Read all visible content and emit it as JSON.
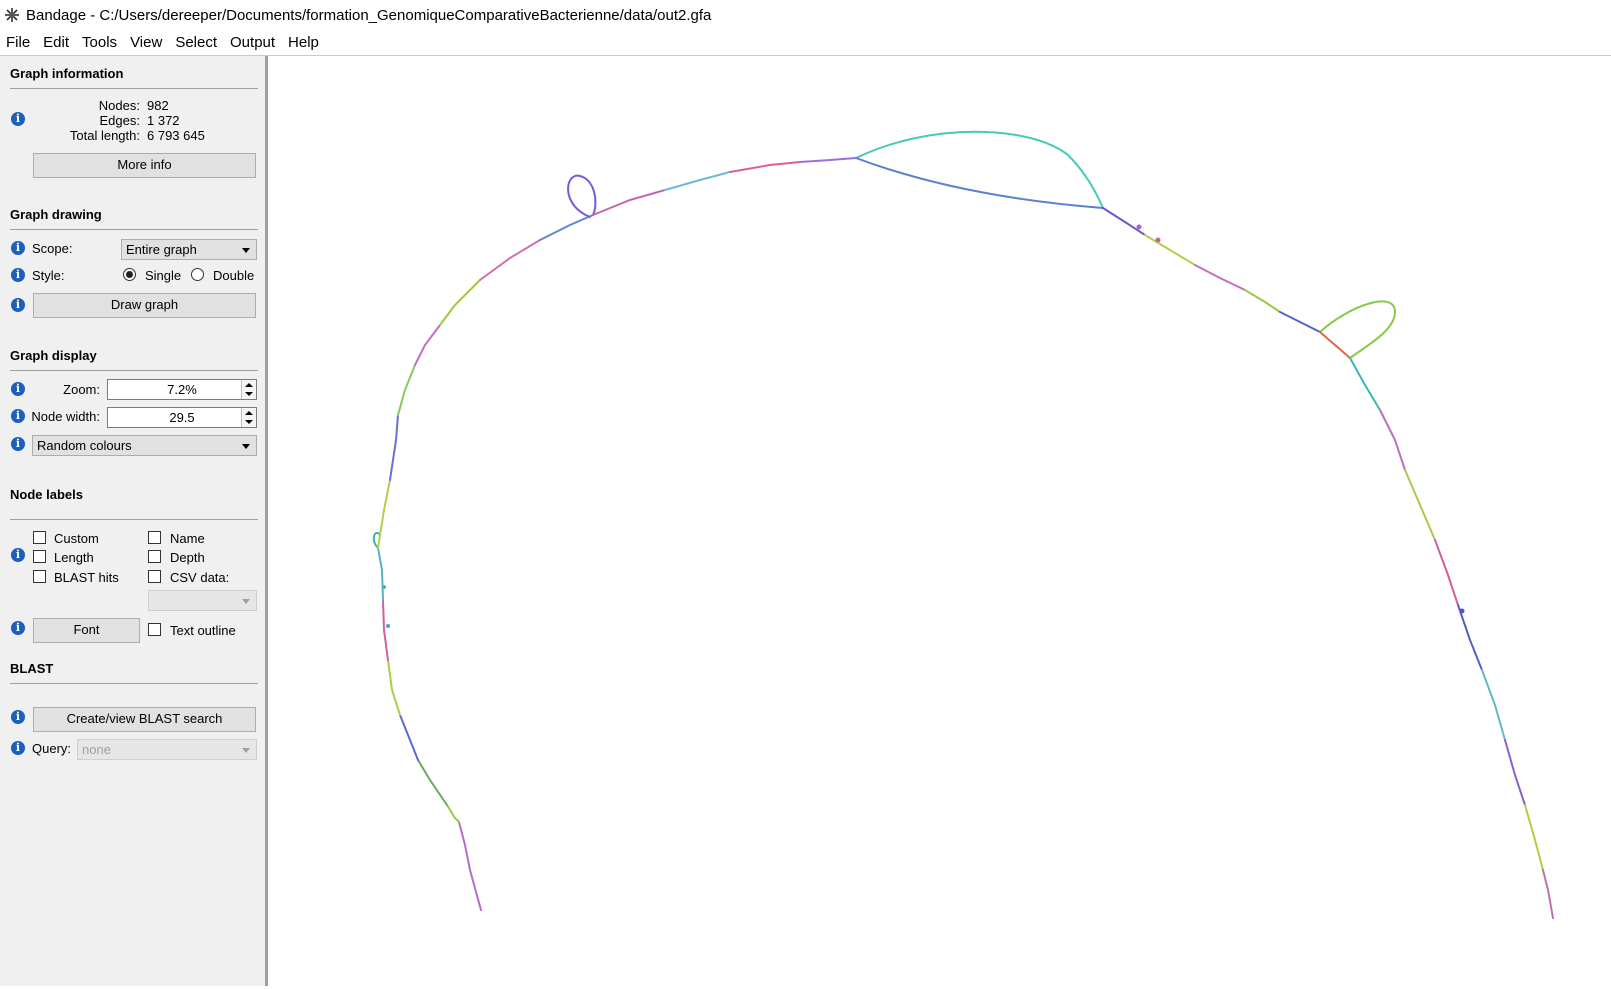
{
  "window": {
    "title": "Bandage - C:/Users/dereeper/Documents/formation_GenomiqueComparativeBacterienne/data/out2.gfa",
    "app_icon": "bandage-icon"
  },
  "menu": [
    "File",
    "Edit",
    "Tools",
    "View",
    "Select",
    "Output",
    "Help"
  ],
  "graph_information": {
    "title": "Graph information",
    "nodes_label": "Nodes:",
    "nodes_value": "982",
    "edges_label": "Edges:",
    "edges_value": "1 372",
    "total_length_label": "Total length:",
    "total_length_value": "6 793 645",
    "more_info_button": "More info"
  },
  "graph_drawing": {
    "title": "Graph drawing",
    "scope_label": "Scope:",
    "scope_value": "Entire graph",
    "style_label": "Style:",
    "style_single": "Single",
    "style_double": "Double",
    "style_selected": "Single",
    "draw_button": "Draw graph"
  },
  "graph_display": {
    "title": "Graph display",
    "zoom_label": "Zoom:",
    "zoom_value": "7.2%",
    "node_width_label": "Node width:",
    "node_width_value": "29.5",
    "colour_scheme": "Random colours"
  },
  "node_labels": {
    "title": "Node labels",
    "custom": "Custom",
    "name": "Name",
    "length": "Length",
    "depth": "Depth",
    "blast_hits": "BLAST hits",
    "csv_data": "CSV data:",
    "font_button": "Font",
    "text_outline": "Text outline"
  },
  "blast": {
    "title": "BLAST",
    "create_button": "Create/view BLAST search",
    "query_label": "Query:",
    "query_value": "none"
  },
  "colors": {
    "info_icon": "#1b5fbf",
    "sidebar_bg": "#f0f0f0",
    "canvas_bg": "#ffffff"
  }
}
